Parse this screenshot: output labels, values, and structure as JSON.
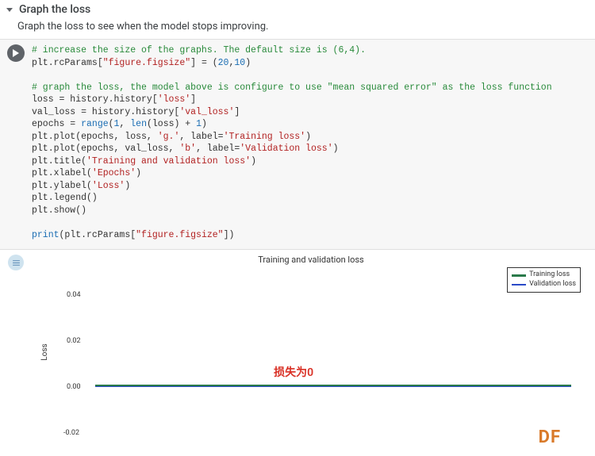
{
  "header": {
    "title": "Graph the loss",
    "description": "Graph the loss to see when the model stops improving."
  },
  "code": {
    "c1": "# increase the size of the graphs. The default size is (6,4).",
    "l2a": "plt.rcParams[",
    "l2s": "\"figure.figsize\"",
    "l2b": "] = (",
    "l2n1": "20",
    "l2c": ",",
    "l2n2": "10",
    "l2d": ")",
    "c3": "# graph the loss, the model above is configure to use \"mean squared error\" as the loss function",
    "l4a": "loss = history.history[",
    "l4s": "'loss'",
    "l4b": "]",
    "l5a": "val_loss = history.history[",
    "l5s": "'val_loss'",
    "l5b": "]",
    "l6a": "epochs = ",
    "l6r": "range",
    "l6b": "(",
    "l6n1": "1",
    "l6c": ", ",
    "l6len": "len",
    "l6d": "(loss) + ",
    "l6n2": "1",
    "l6e": ")",
    "l7a": "plt.plot(epochs, loss, ",
    "l7s1": "'g.'",
    "l7b": ", label=",
    "l7s2": "'Training loss'",
    "l7c": ")",
    "l8a": "plt.plot(epochs, val_loss, ",
    "l8s1": "'b'",
    "l8b": ", label=",
    "l8s2": "'Validation loss'",
    "l8c": ")",
    "l9a": "plt.title(",
    "l9s": "'Training and validation loss'",
    "l9b": ")",
    "l10a": "plt.xlabel(",
    "l10s": "'Epochs'",
    "l10b": ")",
    "l11a": "plt.ylabel(",
    "l11s": "'Loss'",
    "l11b": ")",
    "l12": "plt.legend()",
    "l13": "plt.show()",
    "l14a": "print",
    "l14b": "(plt.rcParams[",
    "l14s": "\"figure.figsize\"",
    "l14c": "])"
  },
  "chart_data": {
    "type": "line",
    "title": "Training and validation loss",
    "ylabel": "Loss",
    "yticks": [
      "0.04",
      "0.02",
      "0.00",
      "-0.02"
    ],
    "ylim": [
      -0.03,
      0.05
    ],
    "series": [
      {
        "name": "Training loss",
        "color": "#2a7a4a",
        "y": 0.0
      },
      {
        "name": "Validation loss",
        "color": "#2a4ac8",
        "y": 0.0
      }
    ],
    "annotations": {
      "red_text": "损失为0",
      "watermark": "DF"
    }
  }
}
